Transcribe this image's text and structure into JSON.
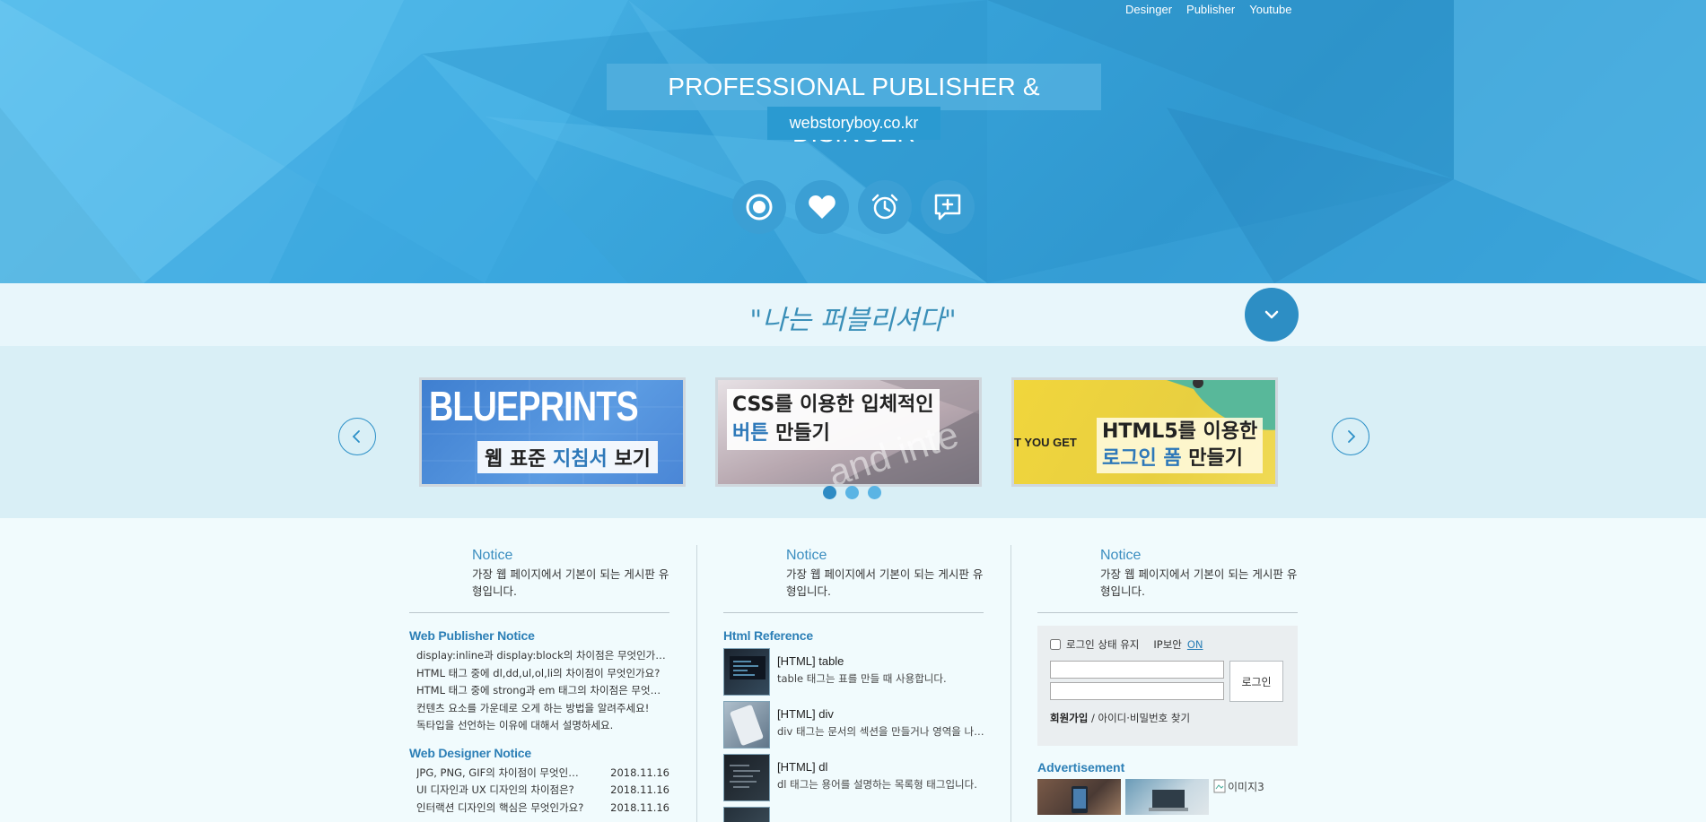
{
  "topnav": {
    "items": [
      "Desinger",
      "Publisher",
      "Youtube"
    ]
  },
  "hero": {
    "title": "PROFESSIONAL PUBLISHER & DISINGER",
    "url": "webstoryboy.co.kr",
    "icons": [
      "record-icon",
      "heart-icon",
      "alarm-icon",
      "add-comment-icon"
    ]
  },
  "slogan": {
    "text": "\"나는 퍼블리셔다\""
  },
  "slider": {
    "slides": [
      {
        "top": "BLUEPRINTS",
        "caption_pre": "웹 표준 ",
        "caption_hl": "지침서",
        "caption_post": " 보기"
      },
      {
        "line1": "CSS를 이용한 입체적인",
        "line2_hl": "버튼",
        "line2_post": " 만들기"
      },
      {
        "line1": "HTML5를 이용한",
        "line2_hl": "로그인 폼",
        "line2_post": " 만들기",
        "bg_text": "T YOU GET"
      }
    ],
    "dots": 3,
    "active_dot": 0
  },
  "notices": [
    {
      "title": "Notice",
      "desc": "가장 웹 페이지에서 기본이 되는 게시판 유형입니다."
    },
    {
      "title": "Notice",
      "desc": "가장 웹 페이지에서 기본이 되는 게시판 유형입니다."
    },
    {
      "title": "Notice",
      "desc": "가장 웹 페이지에서 기본이 되는 게시판 유형입니다."
    }
  ],
  "publisher_notice": {
    "title": "Web Publisher Notice",
    "items": [
      "display:inline과 display:block의 차이점은 무엇인가요?",
      "HTML 태그 중에 dl,dd,ul,ol,li의 차이점이 무엇인가요?",
      "HTML 태그 중에 strong과 em 태그의 차이점은 무엇인가요?",
      "컨텐츠 요소를 가운데로 오게 하는 방법을 알려주세요!",
      "독타입을 선언하는 이유에 대해서 설명하세요."
    ]
  },
  "designer_notice": {
    "title": "Web Designer Notice",
    "items": [
      {
        "title": "JPG, PNG, GIF의 차이점이 무엇인가요?",
        "date": "2018.11.16"
      },
      {
        "title": "UI 디자인과 UX 디자인의 차이점은?",
        "date": "2018.11.16"
      },
      {
        "title": "인터랙션 디자인의 핵심은 무엇인가요?",
        "date": "2018.11.16"
      }
    ]
  },
  "html_reference": {
    "title": "Html Reference",
    "items": [
      {
        "title": "[HTML] table",
        "desc": "table 태그는 표를 만들 때 사용합니다."
      },
      {
        "title": "[HTML] div",
        "desc": "div 태그는 문서의 섹션을 만들거나 영역을 나눌 때 사용합니다."
      },
      {
        "title": "[HTML] dl",
        "desc": "dl 태그는 용어를 설명하는 목록형 태그입니다."
      }
    ]
  },
  "login": {
    "keep_label": "로그인 상태 유지",
    "ip_label": "IP보안",
    "ip_state": "ON",
    "button": "로그인",
    "join": "회원가입",
    "find": " / 아이디·비밀번호 찾기"
  },
  "ads": {
    "title": "Advertisement",
    "broken_alt": "이미지3"
  },
  "colors": {
    "accent": "#2d8ec4",
    "hero": "#3aa6dc",
    "link": "#2c7fb6"
  }
}
